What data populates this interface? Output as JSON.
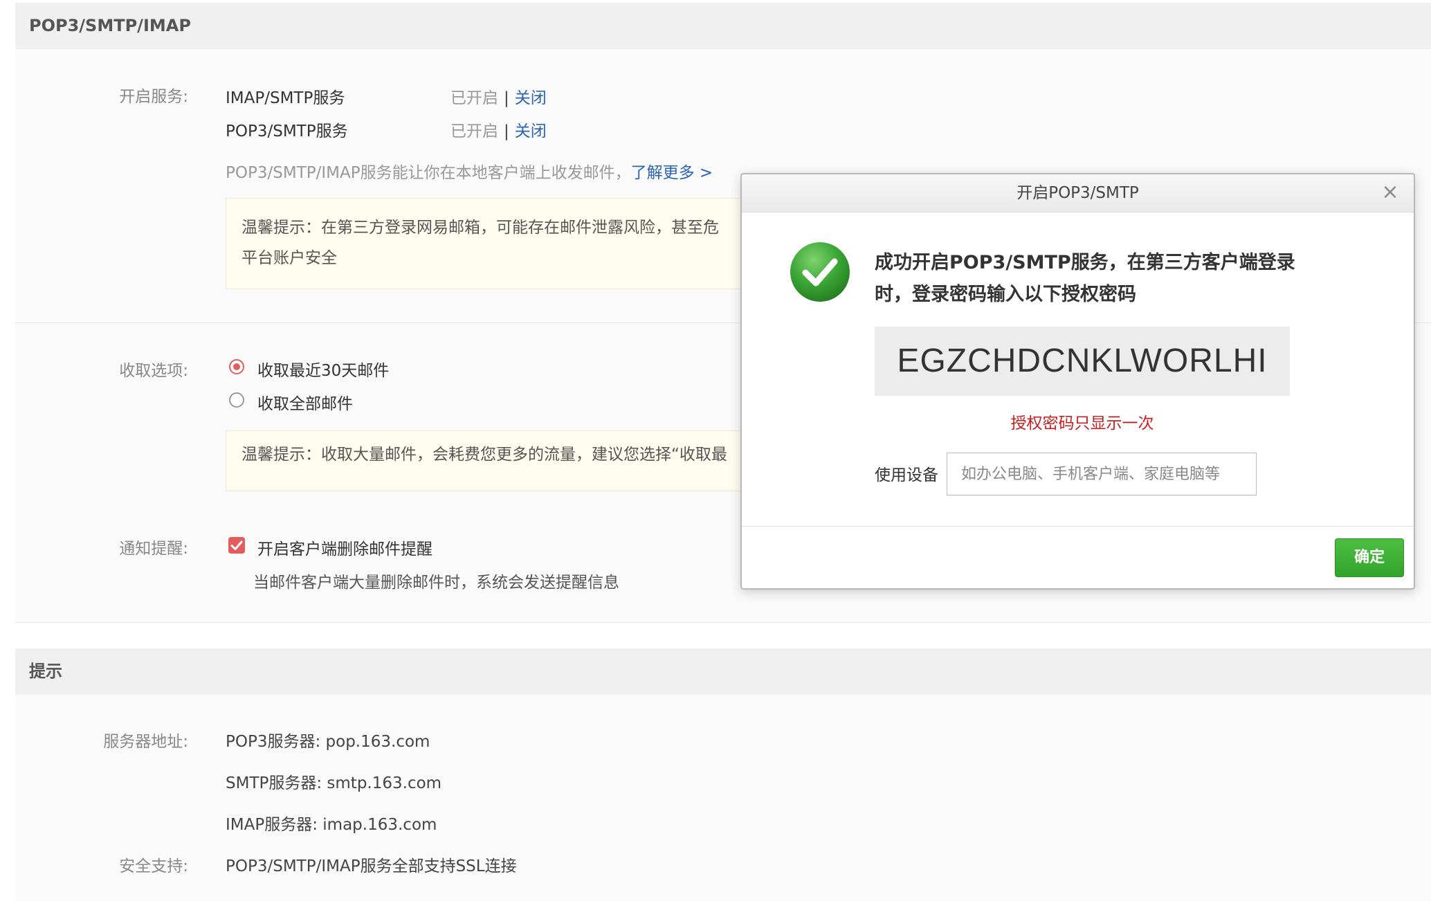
{
  "pop_section": {
    "title": "POP3/SMTP/IMAP",
    "service_label": "开启服务:",
    "services": [
      {
        "name": "IMAP/SMTP服务",
        "status": "已开启",
        "action": "关闭"
      },
      {
        "name": "POP3/SMTP服务",
        "status": "已开启",
        "action": "关闭"
      }
    ],
    "desc": "POP3/SMTP/IMAP服务能让你在本地客户端上收发邮件，",
    "learn_more": "了解更多 >",
    "tip1_line1": "温馨提示：在第三方登录网易邮箱，可能存在邮件泄露风险，甚至危",
    "tip1_line2": "平台账户安全",
    "receive_label": "收取选项:",
    "receive_options": [
      "收取最近30天邮件",
      "收取全部邮件"
    ],
    "receive_selected": 0,
    "tip2": "温馨提示：收取大量邮件，会耗费您更多的流量，建议您选择“收取最",
    "notify_label": "通知提醒:",
    "notify_option": "开启客户端删除邮件提醒",
    "notify_checked": true,
    "notify_desc": "当邮件客户端大量删除邮件时，系统会发送提醒信息"
  },
  "tips_section": {
    "title": "提示",
    "server_label": "服务器地址:",
    "servers": [
      "POP3服务器: pop.163.com",
      "SMTP服务器: smtp.163.com",
      "IMAP服务器: imap.163.com"
    ],
    "security_label": "安全支持:",
    "security_value": "POP3/SMTP/IMAP服务全部支持SSL连接"
  },
  "dialog": {
    "title": "开启POP3/SMTP",
    "close_glyph": "×",
    "message": "成功开启POP3/SMTP服务，在第三方客户端登录时，登录密码输入以下授权密码",
    "auth_code": "EGZCHDCNKLWORLHI",
    "warning": "授权密码只显示一次",
    "device_label": "使用设备",
    "device_placeholder": "如办公电脑、手机客户端、家庭电脑等",
    "device_value": "",
    "ok_label": "确定"
  },
  "colors": {
    "link": "#2c64b4",
    "accent_red": "#e35d5d",
    "warning_red": "#c81e1e",
    "ok_green": "#3fb036",
    "success_green": "#3aa535"
  },
  "icons": {
    "success": "check-circle-icon",
    "close": "close-icon",
    "checkbox": "checkmark-icon"
  }
}
